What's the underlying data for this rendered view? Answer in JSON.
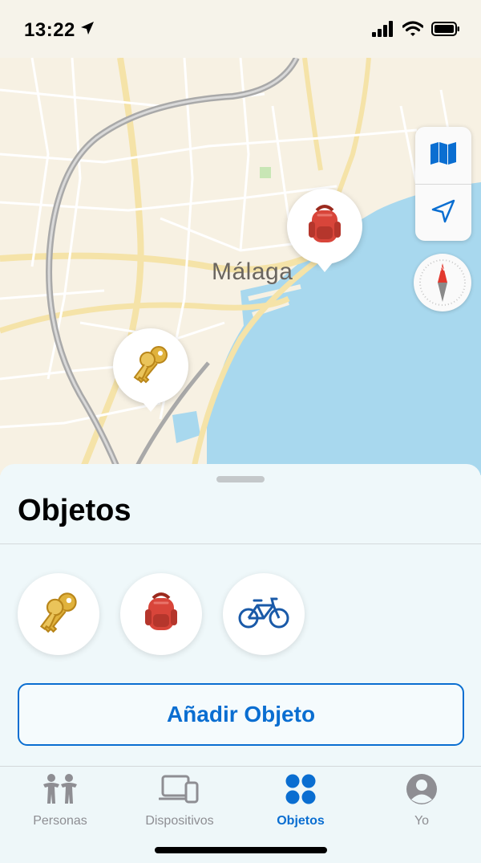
{
  "status_bar": {
    "time": "13:22",
    "icons": [
      "location-arrow-icon",
      "signal-icon",
      "wifi-icon",
      "battery-icon"
    ]
  },
  "map": {
    "city_label": "Málaga",
    "controls": [
      "map-icon",
      "location-icon"
    ],
    "compass_icon": "compass-icon",
    "pins": [
      {
        "item": "backpack",
        "icon": "backpack-icon"
      },
      {
        "item": "keys",
        "icon": "keys-icon"
      }
    ],
    "colors": {
      "land": "#f7f1e3",
      "water": "#a8d8ee",
      "road": "#ffffff",
      "highway": "#a9a9a9",
      "accent_yellow": "#f5e3a8"
    }
  },
  "sheet": {
    "title": "Objetos",
    "items": [
      {
        "name": "keys",
        "icon": "keys-icon"
      },
      {
        "name": "backpack",
        "icon": "backpack-icon"
      },
      {
        "name": "bicycle",
        "icon": "bicycle-icon"
      }
    ],
    "add_button_label": "Añadir Objeto"
  },
  "tab_bar": {
    "tabs": [
      {
        "label": "Personas",
        "icon": "people-icon",
        "active": false
      },
      {
        "label": "Dispositivos",
        "icon": "devices-icon",
        "active": false
      },
      {
        "label": "Objetos",
        "icon": "items-icon",
        "active": true
      },
      {
        "label": "Yo",
        "icon": "person-icon",
        "active": false
      }
    ],
    "accent_color": "#0a6ed1"
  }
}
